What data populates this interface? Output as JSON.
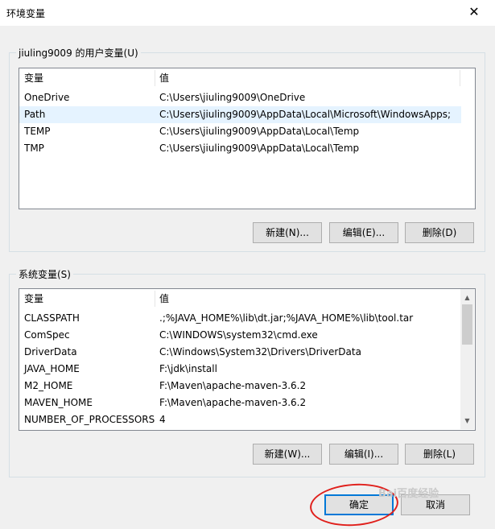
{
  "window": {
    "title": "环境变量",
    "close": "✕"
  },
  "user_vars": {
    "group_title": "jiuling9009 的用户变量(U)",
    "col_name": "变量",
    "col_value": "值",
    "rows": [
      {
        "name": "OneDrive",
        "value": "C:\\Users\\jiuling9009\\OneDrive"
      },
      {
        "name": "Path",
        "value": "C:\\Users\\jiuling9009\\AppData\\Local\\Microsoft\\WindowsApps;"
      },
      {
        "name": "TEMP",
        "value": "C:\\Users\\jiuling9009\\AppData\\Local\\Temp"
      },
      {
        "name": "TMP",
        "value": "C:\\Users\\jiuling9009\\AppData\\Local\\Temp"
      }
    ],
    "new_label": "新建(N)...",
    "edit_label": "编辑(E)...",
    "delete_label": "删除(D)"
  },
  "system_vars": {
    "group_title": "系统变量(S)",
    "col_name": "变量",
    "col_value": "值",
    "rows": [
      {
        "name": "CLASSPATH",
        "value": ".;%JAVA_HOME%\\lib\\dt.jar;%JAVA_HOME%\\lib\\tool.tar"
      },
      {
        "name": "ComSpec",
        "value": "C:\\WINDOWS\\system32\\cmd.exe"
      },
      {
        "name": "DriverData",
        "value": "C:\\Windows\\System32\\Drivers\\DriverData"
      },
      {
        "name": "JAVA_HOME",
        "value": "F:\\jdk\\install"
      },
      {
        "name": "M2_HOME",
        "value": "F:\\Maven\\apache-maven-3.6.2"
      },
      {
        "name": "MAVEN_HOME",
        "value": "F:\\Maven\\apache-maven-3.6.2"
      },
      {
        "name": "NUMBER_OF_PROCESSORS",
        "value": "4"
      }
    ],
    "new_label": "新建(W)...",
    "edit_label": "编辑(I)...",
    "delete_label": "删除(L)"
  },
  "footer": {
    "ok_label": "确定",
    "cancel_label": "取消"
  },
  "overlay": {
    "watermark": "Bai百度经验",
    "highlight_color": "#e0201c"
  }
}
